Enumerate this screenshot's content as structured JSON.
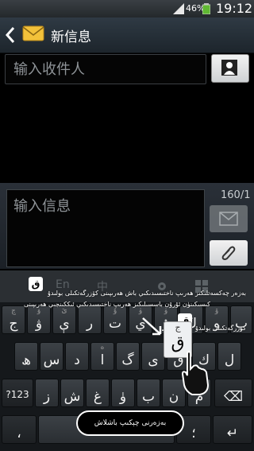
{
  "status": {
    "battery": "46%",
    "time": "19:12"
  },
  "header": {
    "title": "新信息"
  },
  "recipient": {
    "placeholder": "输入收件人"
  },
  "compose": {
    "placeholder": "输入信息",
    "counter": "160/1"
  },
  "toolbar": [
    "中",
    "En"
  ],
  "hints": {
    "line1": "بەزەر چەكسەتلىكىز ھەرىپ ناختىسىدىكىي باش ھەرىپىنى كۆزرگەتكىلى بولىدۇ",
    "line2": "كىسىكىنۈن ئۇرۇن باسسىلىكىز ھەرىپ ناختىسىدىكىي ئىككىنجىي ھەرىپىنى",
    "line3": "كۆزرگەتكىلى بولىدۇ",
    "bubble": "بەزەرنى چېكىپ باشلاش"
  },
  "keys": {
    "row1": [
      {
        "main": "ج",
        "sub": "چ"
      },
      {
        "main": "ۋ",
        "sub": "ۋ"
      },
      {
        "main": "ې",
        "sub": "ێ"
      },
      {
        "main": "ر",
        "sub": ""
      },
      {
        "main": "ت",
        "sub": "ۇ"
      },
      {
        "main": "ي",
        "sub": "ۈ"
      },
      {
        "main": "ۇ",
        "sub": "ۈ"
      },
      {
        "main": "ڭ",
        "sub": ""
      },
      {
        "main": "و",
        "sub": "ۆ"
      },
      {
        "main": "پ",
        "sub": ""
      }
    ],
    "row2": [
      {
        "main": "ھ",
        "sub": ""
      },
      {
        "main": "س",
        "sub": ""
      },
      {
        "main": "د",
        "sub": ""
      },
      {
        "main": "ا",
        "sub": "ە"
      },
      {
        "main": "گ",
        "sub": ""
      },
      {
        "main": "ى",
        "sub": ""
      },
      {
        "main": "ق",
        "sub": "ج"
      },
      {
        "main": "ك",
        "sub": ""
      },
      {
        "main": "ل",
        "sub": ""
      }
    ],
    "row3": [
      {
        "main": "?123",
        "sub": ""
      },
      {
        "main": "ز",
        "sub": ""
      },
      {
        "main": "ش",
        "sub": ""
      },
      {
        "main": "غ",
        "sub": ""
      },
      {
        "main": "ۈ",
        "sub": ""
      },
      {
        "main": "ب",
        "sub": ""
      },
      {
        "main": "ن",
        "sub": ""
      },
      {
        "main": "م",
        "sub": ""
      },
      {
        "main": "⌫",
        "sub": ""
      }
    ],
    "row4": [
      {
        "main": "،",
        "sub": ""
      },
      {
        "main": "",
        "sub": ""
      },
      {
        "main": "؛",
        "sub": ""
      },
      {
        "main": "↵",
        "sub": ""
      }
    ]
  },
  "popup": {
    "main": "ق",
    "sub": "ج"
  },
  "colors": {
    "accent": "#ffffff",
    "background": "#000000"
  },
  "icons": [
    "signal-icon",
    "battery-icon",
    "back-icon",
    "envelope-icon",
    "contact-icon",
    "send-icon",
    "attach-icon",
    "settings-icon",
    "keyboard-icon",
    "app-logo-icon"
  ]
}
